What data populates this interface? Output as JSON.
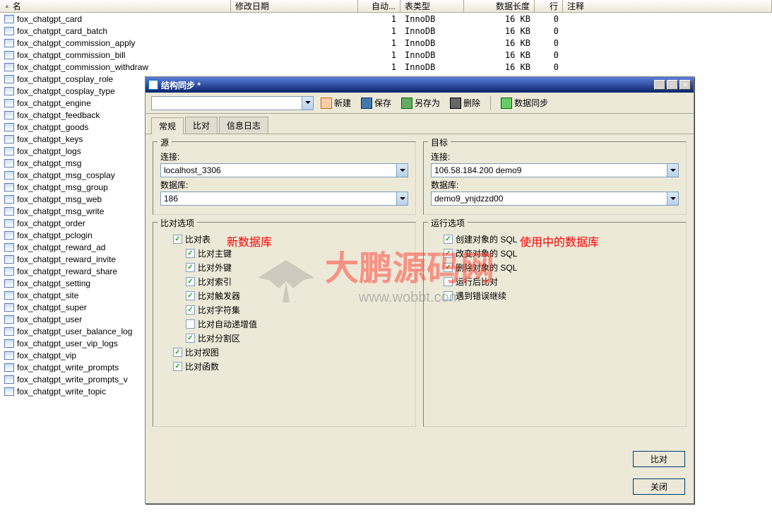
{
  "columns": {
    "name": "名",
    "date": "修改日期",
    "auto": "自动...",
    "type": "表类型",
    "len": "数据长度",
    "rows": "行",
    "comment": "注释"
  },
  "tables": [
    {
      "name": "fox_chatgpt_card",
      "auto": "1",
      "type": "InnoDB",
      "len": "16 KB",
      "rows": "0"
    },
    {
      "name": "fox_chatgpt_card_batch",
      "auto": "1",
      "type": "InnoDB",
      "len": "16 KB",
      "rows": "0"
    },
    {
      "name": "fox_chatgpt_commission_apply",
      "auto": "1",
      "type": "InnoDB",
      "len": "16 KB",
      "rows": "0"
    },
    {
      "name": "fox_chatgpt_commission_bill",
      "auto": "1",
      "type": "InnoDB",
      "len": "16 KB",
      "rows": "0"
    },
    {
      "name": "fox_chatgpt_commission_withdraw",
      "auto": "1",
      "type": "InnoDB",
      "len": "16 KB",
      "rows": "0"
    },
    {
      "name": "fox_chatgpt_cosplay_role"
    },
    {
      "name": "fox_chatgpt_cosplay_type"
    },
    {
      "name": "fox_chatgpt_engine"
    },
    {
      "name": "fox_chatgpt_feedback"
    },
    {
      "name": "fox_chatgpt_goods"
    },
    {
      "name": "fox_chatgpt_keys"
    },
    {
      "name": "fox_chatgpt_logs"
    },
    {
      "name": "fox_chatgpt_msg"
    },
    {
      "name": "fox_chatgpt_msg_cosplay"
    },
    {
      "name": "fox_chatgpt_msg_group"
    },
    {
      "name": "fox_chatgpt_msg_web"
    },
    {
      "name": "fox_chatgpt_msg_write"
    },
    {
      "name": "fox_chatgpt_order"
    },
    {
      "name": "fox_chatgpt_pclogin"
    },
    {
      "name": "fox_chatgpt_reward_ad"
    },
    {
      "name": "fox_chatgpt_reward_invite"
    },
    {
      "name": "fox_chatgpt_reward_share"
    },
    {
      "name": "fox_chatgpt_setting"
    },
    {
      "name": "fox_chatgpt_site"
    },
    {
      "name": "fox_chatgpt_super"
    },
    {
      "name": "fox_chatgpt_user"
    },
    {
      "name": "fox_chatgpt_user_balance_log"
    },
    {
      "name": "fox_chatgpt_user_vip_logs"
    },
    {
      "name": "fox_chatgpt_vip"
    },
    {
      "name": "fox_chatgpt_write_prompts"
    },
    {
      "name": "fox_chatgpt_write_prompts_v"
    },
    {
      "name": "fox_chatgpt_write_topic"
    }
  ],
  "dialog": {
    "title": "结构同步 *",
    "toolbar": {
      "new": "新建",
      "save": "保存",
      "saveas": "另存为",
      "delete": "删除",
      "sync": "数据同步"
    },
    "tabs": {
      "general": "常规",
      "compare": "比对",
      "log": "信息日志"
    },
    "source": {
      "legend": "源",
      "conn_label": "连接:",
      "conn_value": "localhost_3306",
      "db_label": "数据库:",
      "db_value": "186"
    },
    "target": {
      "legend": "目标",
      "conn_label": "连接:",
      "conn_value": "106.58.184.200 demo9",
      "db_label": "数据库:",
      "db_value": "demo9_ynjdzzd00"
    },
    "compare_opts": {
      "legend": "比对选项",
      "compare_table": "比对表",
      "compare_pk": "比对主键",
      "compare_fk": "比对外键",
      "compare_index": "比对索引",
      "compare_trigger": "比对触发器",
      "compare_charset": "比对字符集",
      "compare_autoinc": "比对自动递增值",
      "compare_partition": "比对分割区",
      "compare_view": "比对视图",
      "compare_func": "比对函数"
    },
    "run_opts": {
      "legend": "运行选项",
      "create_sql": "创建对象的 SQL",
      "alter_sql": "改变对象的 SQL",
      "drop_sql": "删除对象的 SQL",
      "run_after": "运行后比对",
      "continue_err": "遇到错误继续"
    },
    "buttons": {
      "compare": "比对",
      "close": "关闭"
    }
  },
  "annotations": {
    "new_db": "新数据库",
    "using_db": "使用中的数据库"
  },
  "watermark": {
    "text": "大鹏源码网",
    "url": "www.wobbt.com"
  }
}
